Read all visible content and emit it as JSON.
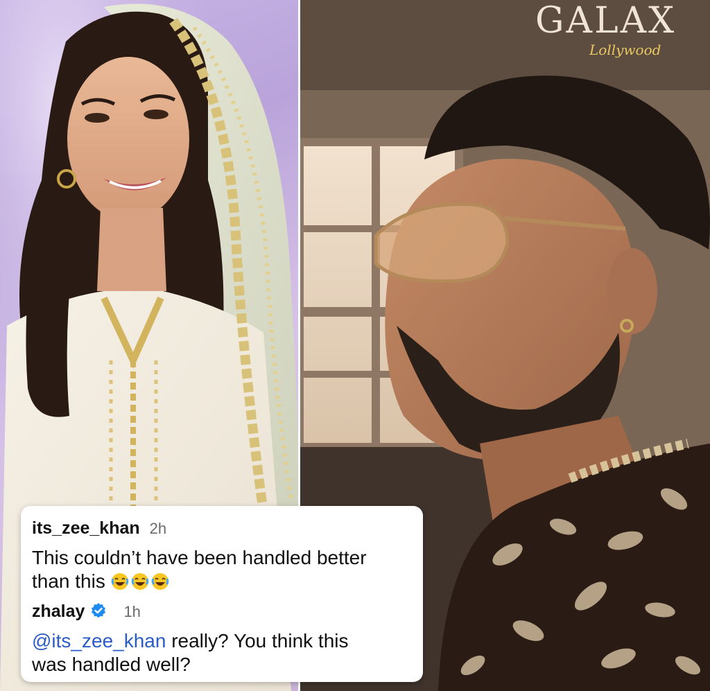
{
  "watermark": {
    "main": "GALAX",
    "sub": "Lollywood"
  },
  "comments": [
    {
      "username": "its_zee_khan",
      "time": "2h",
      "text_line1": "This couldn’t have been handled better",
      "text_line2": "than this",
      "emoji": "face-with-tears-of-joy",
      "emoji_count": 3
    },
    {
      "username": "zhalay",
      "verified": true,
      "time": "1h",
      "mention": "@its_zee_khan",
      "text_line1_rest": " really? You think this",
      "text_line2": "was handled well?"
    }
  ],
  "colors": {
    "mention": "#2b5cc7",
    "verified_badge": "#1d8cf0",
    "watermark_gold": "#e9c862"
  },
  "icons": [
    "verified-badge-icon",
    "laughing-emoji-icon"
  ]
}
